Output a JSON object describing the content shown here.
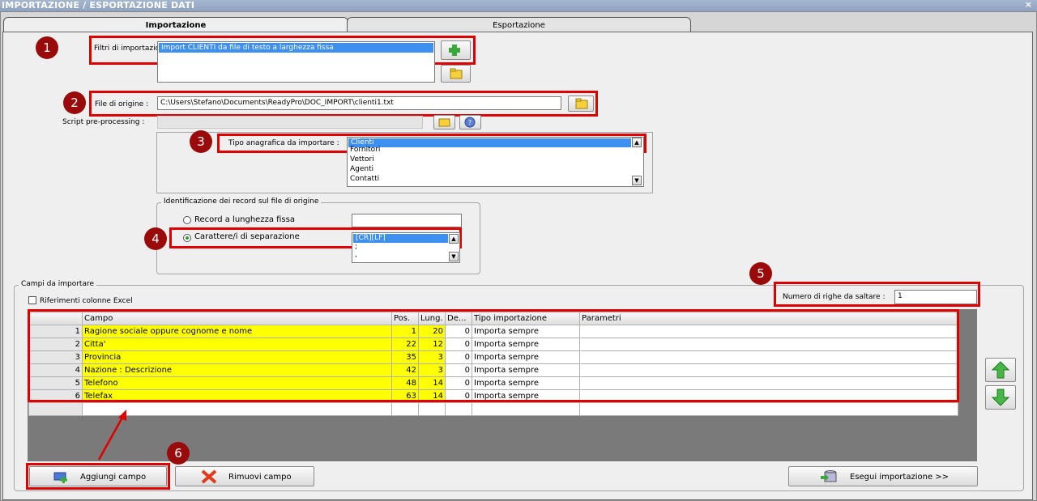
{
  "window": {
    "title": "IMPORTAZIONE / ESPORTAZIONE DATI",
    "close": "×"
  },
  "tabs": [
    "Importazione",
    "Esportazione"
  ],
  "filters": {
    "label": "Filtri di importazione :",
    "selected": "Import CLIENTI da file di testo a larghezza fissa"
  },
  "source": {
    "label": "File di origine :",
    "value": "C:\\Users\\Stefano\\Documents\\ReadyPro\\DOC_IMPORT\\clienti1.txt"
  },
  "script": {
    "label": "Script pre-processing :"
  },
  "registry": {
    "label": "Tipo anagrafica da importare :",
    "selected": "Clienti",
    "items": [
      "Fornitori",
      "Vettori",
      "Agenti",
      "Contatti"
    ]
  },
  "records": {
    "group_label": "Identificazione dei record sul file di origine",
    "option_fixed": "Record a lunghezza fissa",
    "option_sep": "Carattere/i di separazione",
    "sep_selected": "[CR][LF]",
    "sep_items": [
      ";",
      ","
    ]
  },
  "fields": {
    "group_label": "Campi da importare",
    "excel_refs_label": "Riferimenti colonne Excel",
    "skip_label": "Numero di righe da saltare :",
    "skip_value": "1",
    "columns": [
      "Campo",
      "Pos.",
      "Lung.",
      "De...",
      "Tipo importazione",
      "Parametri"
    ],
    "rows": [
      {
        "n": "1",
        "campo": "Ragione sociale oppure cognome e nome",
        "pos": "1",
        "lung": "20",
        "dec": "0",
        "tipo": "Importa sempre",
        "param": ""
      },
      {
        "n": "2",
        "campo": "Citta'",
        "pos": "22",
        "lung": "12",
        "dec": "0",
        "tipo": "Importa sempre",
        "param": ""
      },
      {
        "n": "3",
        "campo": "Provincia",
        "pos": "35",
        "lung": "3",
        "dec": "0",
        "tipo": "Importa sempre",
        "param": ""
      },
      {
        "n": "4",
        "campo": "Nazione : Descrizione",
        "pos": "42",
        "lung": "3",
        "dec": "0",
        "tipo": "Importa sempre",
        "param": ""
      },
      {
        "n": "5",
        "campo": "Telefono",
        "pos": "48",
        "lung": "14",
        "dec": "0",
        "tipo": "Importa sempre",
        "param": ""
      },
      {
        "n": "6",
        "campo": "Telefax",
        "pos": "63",
        "lung": "14",
        "dec": "0",
        "tipo": "Importa sempre",
        "param": ""
      }
    ]
  },
  "buttons": {
    "add_field": "Aggiungi campo",
    "remove_field": "Rimuovi campo",
    "run_import": "Esegui importazione >>"
  },
  "badges": [
    "1",
    "2",
    "3",
    "4",
    "5",
    "6"
  ],
  "colors": {
    "highlight": "#e00000",
    "badge": "#9a0a0a",
    "row_fill": "#ffff00",
    "selection": "#3d8ff0"
  }
}
